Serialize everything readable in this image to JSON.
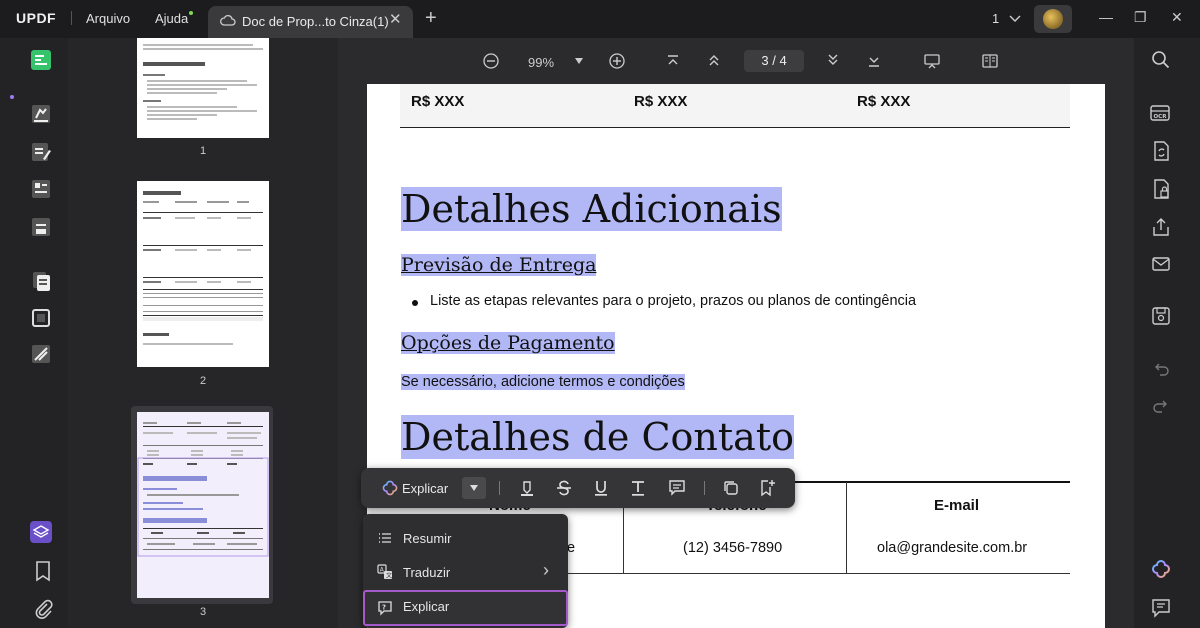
{
  "app": {
    "logo": "UPDF",
    "menus": [
      "Arquivo",
      "Ajuda"
    ],
    "tab_title": "Doc de Prop...to Cinza(1)",
    "tab_close": "✕",
    "tab_add": "+",
    "page_selector": "1",
    "window_min": "—",
    "window_restore": "❐",
    "window_close": "✕"
  },
  "toolbar": {
    "zoom": "99%",
    "current_page": "3",
    "page_sep": "/",
    "total_pages": "4"
  },
  "thumbnails": [
    {
      "label": "1"
    },
    {
      "label": "2"
    },
    {
      "label": "3"
    }
  ],
  "document": {
    "price_cells": [
      "R$ XXX",
      "R$ XXX",
      "R$ XXX"
    ],
    "heading_details": "Detalhes Adicionais",
    "sub_delivery": "Previsão de Entrega",
    "bullet_delivery": "Liste as etapas relevantes para o projeto, prazos ou planos de contingência",
    "sub_payment": "Opções de Pagamento",
    "payment_text": "Se necessário, adicione termos e condições",
    "heading_contact": "Detalhes de Contato",
    "contact_table": {
      "headers": [
        "Nome",
        "Telefone",
        "E-mail"
      ],
      "row": [
        "e",
        "(12) 3456-7890",
        "ola@grandesite.com.br"
      ]
    }
  },
  "context_toolbar": {
    "ai_label": "Explicar"
  },
  "ai_dropdown": {
    "items": [
      {
        "label": "Resumir"
      },
      {
        "label": "Traduzir",
        "arrow": "›"
      },
      {
        "label": "Explicar"
      }
    ]
  },
  "colors": {
    "highlight": "#b2b8f5",
    "accent_purple": "#a45ac9",
    "edit_green": "#7ed957"
  }
}
